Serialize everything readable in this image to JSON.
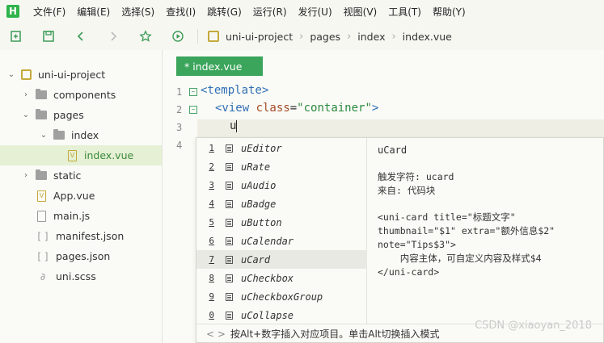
{
  "menubar": {
    "items": [
      "文件(F)",
      "编辑(E)",
      "选择(S)",
      "查找(I)",
      "跳转(G)",
      "运行(R)",
      "发行(U)",
      "视图(V)",
      "工具(T)",
      "帮助(Y)"
    ]
  },
  "breadcrumb": [
    "uni-ui-project",
    "pages",
    "index",
    "index.vue"
  ],
  "tree": {
    "project": "uni-ui-project",
    "components": "components",
    "pages": "pages",
    "index_folder": "index",
    "index_vue": "index.vue",
    "static": "static",
    "app_vue": "App.vue",
    "main_js": "main.js",
    "manifest": "manifest.json",
    "pages_json": "pages.json",
    "uni_scss": "uni.scss"
  },
  "editor": {
    "tab_label": "* index.vue",
    "line_numbers": [
      "1",
      "2",
      "3",
      "4"
    ],
    "line1": "<template>",
    "line2_open": "<view ",
    "line2_attr": "class",
    "line2_eq": "=",
    "line2_str": "\"container\"",
    "line2_close": ">",
    "line3_typed": "u"
  },
  "autocomplete": {
    "items": [
      {
        "num": "1",
        "label": "uEditor"
      },
      {
        "num": "2",
        "label": "uRate"
      },
      {
        "num": "3",
        "label": "uAudio"
      },
      {
        "num": "4",
        "label": "uBadge"
      },
      {
        "num": "5",
        "label": "uButton"
      },
      {
        "num": "6",
        "label": "uCalendar"
      },
      {
        "num": "7",
        "label": "uCard"
      },
      {
        "num": "8",
        "label": "uCheckbox"
      },
      {
        "num": "9",
        "label": "uCheckboxGroup"
      },
      {
        "num": "0",
        "label": "uCollapse"
      }
    ],
    "selected_index": 6,
    "detail": {
      "title": "uCard",
      "trigger": "触发字符: ucard",
      "source": "来自: 代码块",
      "code1": "<uni-card title=\"标题文字\"",
      "code2": "thumbnail=\"$1\" extra=\"额外信息$2\"",
      "code3": "note=\"Tips$3\">",
      "code4": "    内容主体，可自定义内容及样式$4",
      "code5": "</uni-card>"
    },
    "footer": "按Alt+数字插入对应项目。单击Alt切换插入模式"
  },
  "watermark": "CSDN @xiaoyan_2018",
  "colors": {
    "accent_green": "#3ba55c",
    "tag_blue": "#2e6fb5",
    "attr_brown": "#a44b25",
    "string_green": "#2b8a3e"
  }
}
